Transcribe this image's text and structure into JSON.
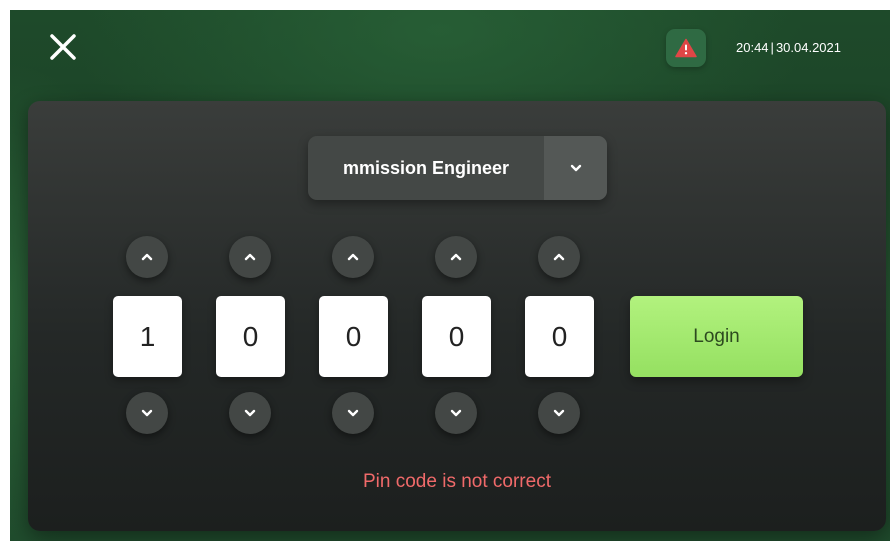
{
  "header": {
    "close_icon": "close-icon",
    "alert_icon": "warning-triangle-icon",
    "time": "20:44",
    "separator": "|",
    "date": "30.04.2021",
    "alert_color": "#e04646"
  },
  "role_select": {
    "selected": "mmission Engineer",
    "caret_icon": "chevron-down-icon"
  },
  "pin": {
    "digits": [
      "1",
      "0",
      "0",
      "0",
      "0"
    ],
    "increment_icon": "chevron-up-icon",
    "decrement_icon": "chevron-down-icon"
  },
  "login_button": {
    "label": "Login",
    "color": "#a4ea70"
  },
  "error_message": "Pin code is not correct",
  "colors": {
    "error": "#f06a6a",
    "panel": "#2a2e2c",
    "background": "#1e4a2a"
  }
}
